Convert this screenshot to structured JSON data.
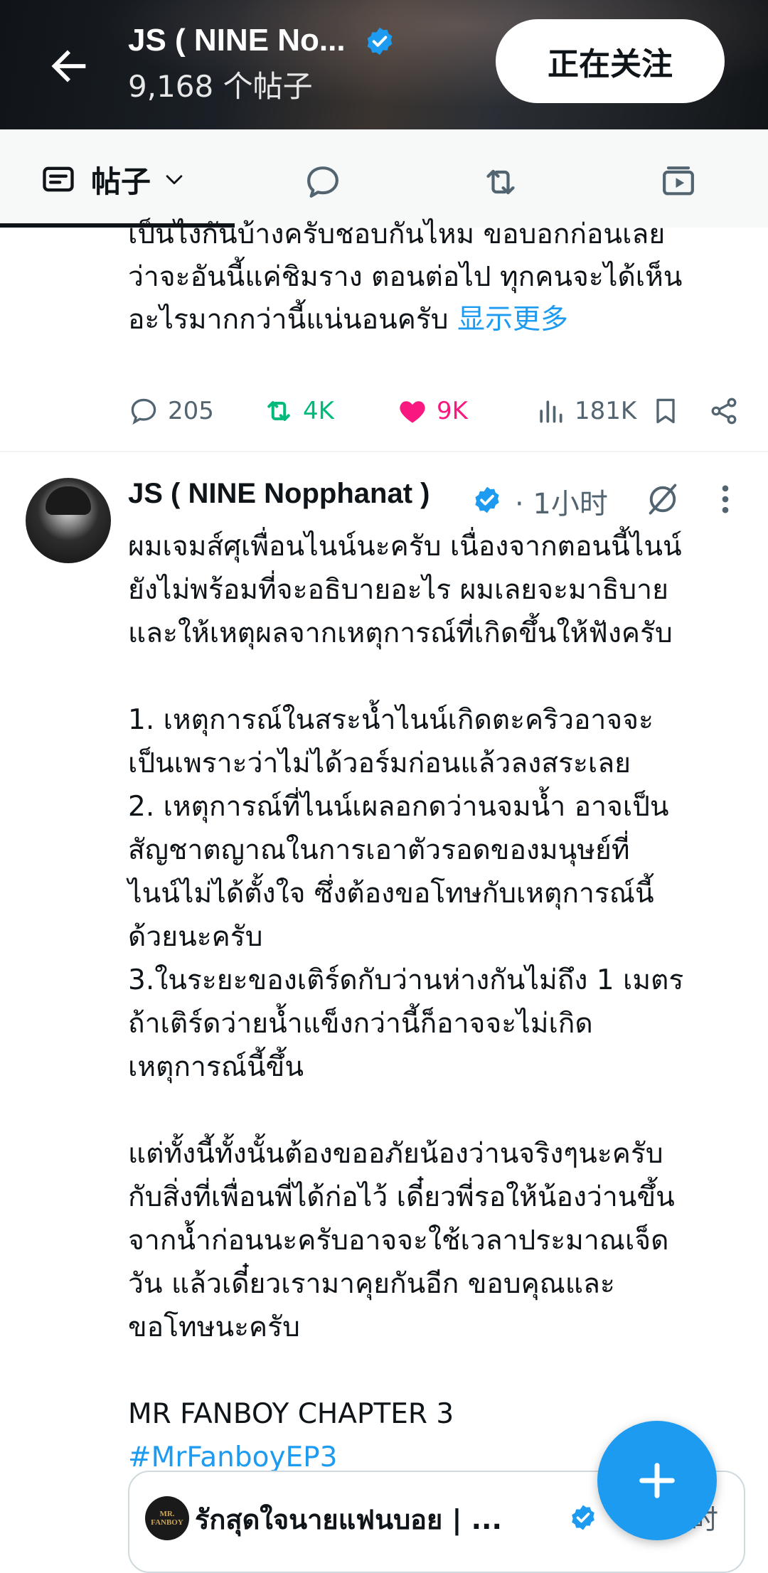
{
  "header": {
    "title": "JS ( NINE No...",
    "post_count": "9,168 个帖子",
    "follow_label": "正在关注"
  },
  "tabs": {
    "posts_label": "帖子",
    "icons": [
      "posts-icon",
      "replies-icon",
      "reposts-icon",
      "media-icon"
    ]
  },
  "tweet1": {
    "text_partial_hidden": "",
    "text_line1": "เป็นไงกันบ้างครับชอบกันไหม ขอบอกก่อนเลย",
    "text_line2": "ว่าจะอันนี้แค่ชิมราง ตอนต่อไป ทุกคนจะได้เห็น",
    "text_line3": "อะไรมากกว่านี้แน่นอนครับ",
    "show_more": "显示更多",
    "replies": "205",
    "reposts": "4K",
    "likes": "9K",
    "views": "181K"
  },
  "tweet2": {
    "name": "JS ( NINE Nopphanat )",
    "time": "· 1小时",
    "body": "ผมเจมส์ศุเพื่อนไนน์นะครับ เนื่องจากตอนนี้ไนน์\nยังไม่พร้อมที่จะอธิบายอะไร ผมเลยจะมาธิบาย\nและให้เหตุผลจากเหตุการณ์ที่เกิดขึ้นให้ฟังครับ\n\n1. เหตุการณ์ในสระน้ำไนน์เกิดตะคริวอาจจะ\nเป็นเพราะว่าไม่ได้วอร์มก่อนแล้วลงสระเลย\n2. เหตุการณ์ที่ไนน์เผลอกดว่านจมน้ำ อาจเป็น\nสัญชาตญาณในการเอาตัวรอดของมนุษย์ที่\nไนน์ไม่ได้ตั้งใจ ซึ่งต้องขอโทษกับเหตุการณ์นี้\nด้วยนะครับ\n3.ในระยะของเติร์ดกับว่านห่างกันไม่ถึง 1 เมตร\nถ้าเติร์ดว่ายน้ำแข็งกว่านี้ก็อาจจะไม่เกิด\nเหตุการณ์นี้ขึ้น\n\nแต่ทั้งนี้ทั้งนั้นต้องขออภัยน้องว่านจริงๆนะครับ\nกับสิ่งที่เพื่อนพี่ได้ก่อไว้ เดี๋ยวพี่รอให้น้องว่านขึ้น\nจากน้ำก่อนนะครับอาจจะใช้เวลาประมาณเจ็ด\nวัน แล้วเดี๋ยวเรามาคุยกันอีก ขอบคุณและ\nขอโทษนะครับ\n\nMR FANBOY CHAPTER 3",
    "hashtag": "#MrFanboyEP3"
  },
  "quote": {
    "avatar_text": "MR. FANBOY",
    "name": "รักสุดใจนายแฟนบอย | ...",
    "time": "时"
  },
  "colors": {
    "accent": "#1d9bf0",
    "repost_green": "#00ba7c",
    "like_pink": "#f91880",
    "muted": "#536471"
  }
}
